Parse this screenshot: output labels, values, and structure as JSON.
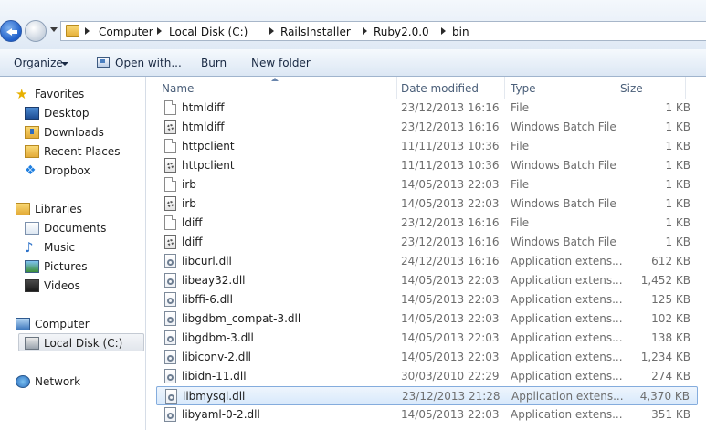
{
  "address_bar": {
    "breadcrumbs": [
      "Computer",
      "Local Disk (C:)",
      "RailsInstaller",
      "Ruby2.0.0",
      "bin"
    ]
  },
  "toolbar": {
    "organize": "Organize",
    "open_with": "Open with...",
    "burn": "Burn",
    "new_folder": "New folder"
  },
  "nav": {
    "favorites": "Favorites",
    "desktop": "Desktop",
    "downloads": "Downloads",
    "recent_places": "Recent Places",
    "dropbox": "Dropbox",
    "libraries": "Libraries",
    "documents": "Documents",
    "music": "Music",
    "pictures": "Pictures",
    "videos": "Videos",
    "computer": "Computer",
    "local_disk": "Local Disk (C:)",
    "network": "Network"
  },
  "columns": {
    "name": "Name",
    "date_modified": "Date modified",
    "type": "Type",
    "size": "Size"
  },
  "files": [
    {
      "name": "htmldiff",
      "date": "23/12/2013 16:16",
      "type": "File",
      "size": "1 KB",
      "icon": "file-icon"
    },
    {
      "name": "htmldiff",
      "date": "23/12/2013 16:16",
      "type": "Windows Batch File",
      "size": "1 KB",
      "icon": "batch-file-icon"
    },
    {
      "name": "httpclient",
      "date": "11/11/2013 10:36",
      "type": "File",
      "size": "1 KB",
      "icon": "file-icon"
    },
    {
      "name": "httpclient",
      "date": "11/11/2013 10:36",
      "type": "Windows Batch File",
      "size": "1 KB",
      "icon": "batch-file-icon"
    },
    {
      "name": "irb",
      "date": "14/05/2013 22:03",
      "type": "File",
      "size": "1 KB",
      "icon": "file-icon"
    },
    {
      "name": "irb",
      "date": "14/05/2013 22:03",
      "type": "Windows Batch File",
      "size": "1 KB",
      "icon": "batch-file-icon"
    },
    {
      "name": "ldiff",
      "date": "23/12/2013 16:16",
      "type": "File",
      "size": "1 KB",
      "icon": "file-icon"
    },
    {
      "name": "ldiff",
      "date": "23/12/2013 16:16",
      "type": "Windows Batch File",
      "size": "1 KB",
      "icon": "batch-file-icon"
    },
    {
      "name": "libcurl.dll",
      "date": "24/12/2013 16:16",
      "type": "Application extens...",
      "size": "612 KB",
      "icon": "dll-icon"
    },
    {
      "name": "libeay32.dll",
      "date": "14/05/2013 22:03",
      "type": "Application extens...",
      "size": "1,452 KB",
      "icon": "dll-icon"
    },
    {
      "name": "libffi-6.dll",
      "date": "14/05/2013 22:03",
      "type": "Application extens...",
      "size": "125 KB",
      "icon": "dll-icon"
    },
    {
      "name": "libgdbm_compat-3.dll",
      "date": "14/05/2013 22:03",
      "type": "Application extens...",
      "size": "102 KB",
      "icon": "dll-icon"
    },
    {
      "name": "libgdbm-3.dll",
      "date": "14/05/2013 22:03",
      "type": "Application extens...",
      "size": "138 KB",
      "icon": "dll-icon"
    },
    {
      "name": "libiconv-2.dll",
      "date": "14/05/2013 22:03",
      "type": "Application extens...",
      "size": "1,234 KB",
      "icon": "dll-icon"
    },
    {
      "name": "libidn-11.dll",
      "date": "30/03/2010 22:29",
      "type": "Application extens...",
      "size": "274 KB",
      "icon": "dll-icon"
    },
    {
      "name": "libmysql.dll",
      "date": "23/12/2013 21:28",
      "type": "Application extens...",
      "size": "4,370 KB",
      "icon": "dll-icon",
      "selected": true
    },
    {
      "name": "libyaml-0-2.dll",
      "date": "14/05/2013 22:03",
      "type": "Application extens...",
      "size": "351 KB",
      "icon": "dll-icon"
    }
  ],
  "colors": {
    "selection_bg": "#d8e9fb",
    "selection_border": "#84acdd",
    "header_text": "#4c607a",
    "meta_text": "#6d6d6d"
  }
}
